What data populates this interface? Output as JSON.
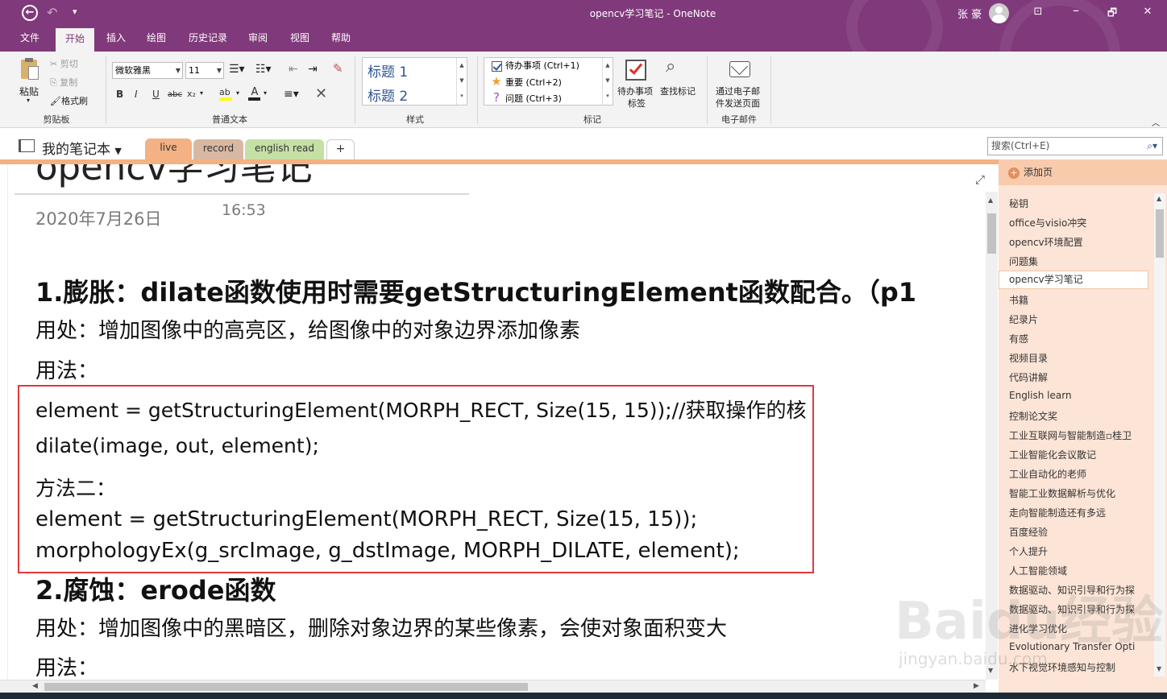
{
  "window": {
    "title": "opencv学习笔记  -  OneNote",
    "user": "张 豪",
    "controls": [
      "⊡",
      "🗗",
      "✕"
    ]
  },
  "menu": [
    "文件",
    "开始",
    "插入",
    "绘图",
    "历史记录",
    "审阅",
    "视图",
    "帮助"
  ],
  "ribbon": {
    "clipboard": {
      "paste": "粘贴",
      "cut": "剪切",
      "copy": "复制",
      "format_painter": "格式刷",
      "label": "剪贴板"
    },
    "font": {
      "family": "微软雅黑",
      "size": "11",
      "bold": "B",
      "italic": "I",
      "underline": "U",
      "strike": "abc",
      "subscript": "x₂",
      "label": "普通文本"
    },
    "styles": {
      "h1": "标题 1",
      "h2": "标题 2",
      "label": "样式"
    },
    "tags": {
      "todo": "待办事项 (Ctrl+1)",
      "important": "重要 (Ctrl+2)",
      "question": "问题 (Ctrl+3)",
      "todo_tag": "待办事项",
      "todo_tag2": "标签",
      "find_tags": "查找标记",
      "label": "标记"
    },
    "email": {
      "btn1": "通过电子邮",
      "btn2": "件发送页面",
      "label": "电子邮件"
    }
  },
  "notebook": {
    "name": "我的笔记本",
    "sections": [
      "live",
      "record",
      "english read"
    ],
    "add": "+",
    "search_placeholder": "搜索(Ctrl+E)"
  },
  "page": {
    "title": "opencv学习笔记",
    "date": "2020年7月26日",
    "time": "16:53",
    "h1_1": "1.膨胀：dilate函数使用时需要getStructuringElement函数配合。（p1",
    "usage1": "用处：增加图像中的高亮区，给图像中的对象边界添加像素",
    "method1": "用法：",
    "code1": "element = getStructuringElement(MORPH_RECT, Size(15, 15));//获取操作的核",
    "code2": "dilate(image, out,  element);",
    "code3": "方法二：",
    "code4": "element = getStructuringElement(MORPH_RECT, Size(15, 15));",
    "code5": "morphologyEx(g_srcImage, g_dstImage, MORPH_DILATE, element);",
    "h1_2": "2.腐蚀：erode函数",
    "usage2": "用处：增加图像中的黑暗区，删除对象边界的某些像素，会使对象面积变大",
    "method2": "用法："
  },
  "pagelist": {
    "add_page": "添加页",
    "items": [
      "秘钥",
      "office与visio冲突",
      "opencv环境配置",
      "问题集",
      "opencv学习笔记",
      "书籍",
      "纪录片",
      "有感",
      "视频目录",
      "代码讲解",
      "English learn",
      "控制论文奖",
      "工业互联网与智能制造▫桂卫",
      "工业智能化会议散记",
      "工业自动化的老师",
      "智能工业数据解析与优化",
      "走向智能制造还有多远",
      "百度经验",
      "个人提升",
      "人工智能领域",
      "数据驱动、知识引导和行为探",
      "数据驱动、知识引导和行为探",
      "进化学习优化",
      "Evolutionary Transfer Opti",
      "水下视觉环境感知与控制"
    ]
  },
  "watermark": {
    "main": "Baidu经验",
    "sub": "jingyan.baidu.com"
  }
}
